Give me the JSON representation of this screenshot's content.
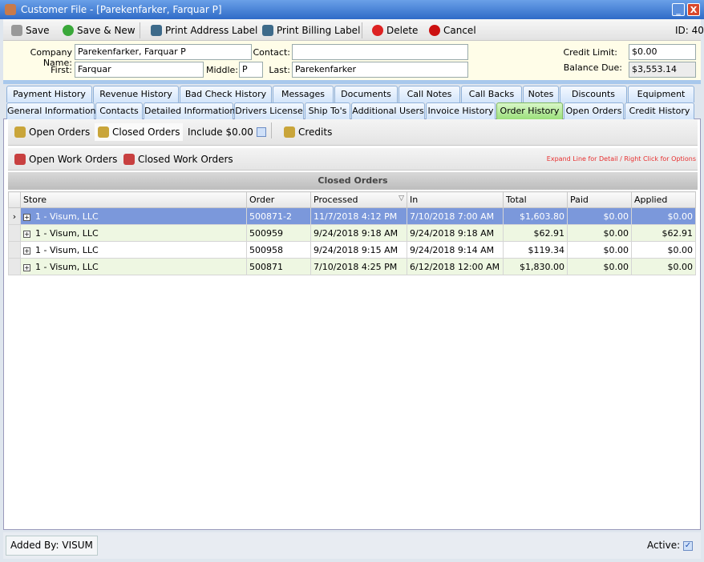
{
  "window": {
    "title": "Customer File - [Parekenfarker, Farquar P]",
    "minimize": "_",
    "close": "X"
  },
  "toolbar": {
    "save": "Save",
    "save_new": "Save & New",
    "print_address": "Print Address Label",
    "print_billing": "Print Billing Label",
    "delete": "Delete",
    "cancel": "Cancel",
    "id": "ID: 40"
  },
  "form": {
    "company_label": "Company Name:",
    "company": "Parekenfarker, Farquar P",
    "contact_label": "Contact:",
    "contact": "",
    "first_label": "First:",
    "first": "Farquar",
    "middle_label": "Middle:",
    "middle": "P",
    "last_label": "Last:",
    "last": "Parekenfarker",
    "credit_label": "Credit Limit:",
    "credit": "$0.00",
    "balance_label": "Balance Due:",
    "balance": "$3,553.14"
  },
  "tabs_row1": [
    "Payment History",
    "Revenue History",
    "Bad Check History",
    "Messages",
    "Documents",
    "Call Notes",
    "Call Backs",
    "Notes",
    "Discounts",
    "Equipment"
  ],
  "tabs_row2": [
    "General Information",
    "Contacts",
    "Detailed Information",
    "Drivers License",
    "Ship To's",
    "Additional Users",
    "Invoice History",
    "Order History",
    "Open Orders",
    "Credit History"
  ],
  "active_tab": "Order History",
  "orders_bar": {
    "open": "Open Orders",
    "closed": "Closed Orders",
    "include": "Include $0.00",
    "include_checked": false,
    "credits": "Credits",
    "open_work": "Open Work Orders",
    "closed_work": "Closed Work Orders",
    "hint": "Expand Line for Detail / Right Click for Options"
  },
  "grid": {
    "title": "Closed Orders",
    "columns": [
      "Store",
      "Order",
      "Processed",
      "In",
      "Total",
      "Paid",
      "Applied"
    ],
    "rows": [
      [
        "1 - Visum, LLC",
        "500871-2",
        "11/7/2018 4:12 PM",
        "7/10/2018 7:00 AM",
        "$1,603.80",
        "$0.00",
        "$0.00"
      ],
      [
        "1 - Visum, LLC",
        "500959",
        "9/24/2018 9:18 AM",
        "9/24/2018 9:18 AM",
        "$62.91",
        "$0.00",
        "$62.91"
      ],
      [
        "1 - Visum, LLC",
        "500958",
        "9/24/2018 9:15 AM",
        "9/24/2018 9:14 AM",
        "$119.34",
        "$0.00",
        "$0.00"
      ],
      [
        "1 - Visum, LLC",
        "500871",
        "7/10/2018 4:25 PM",
        "6/12/2018 12:00 AM",
        "$1,830.00",
        "$0.00",
        "$0.00"
      ]
    ]
  },
  "footer": {
    "added_by": "Added By: VISUM",
    "active": "Active:",
    "active_checked": true
  },
  "colors": {
    "selected_row": "#7b98db",
    "alt_row": "#eef7e2",
    "active_tab": "#9be07b",
    "hint": "#e83030"
  }
}
